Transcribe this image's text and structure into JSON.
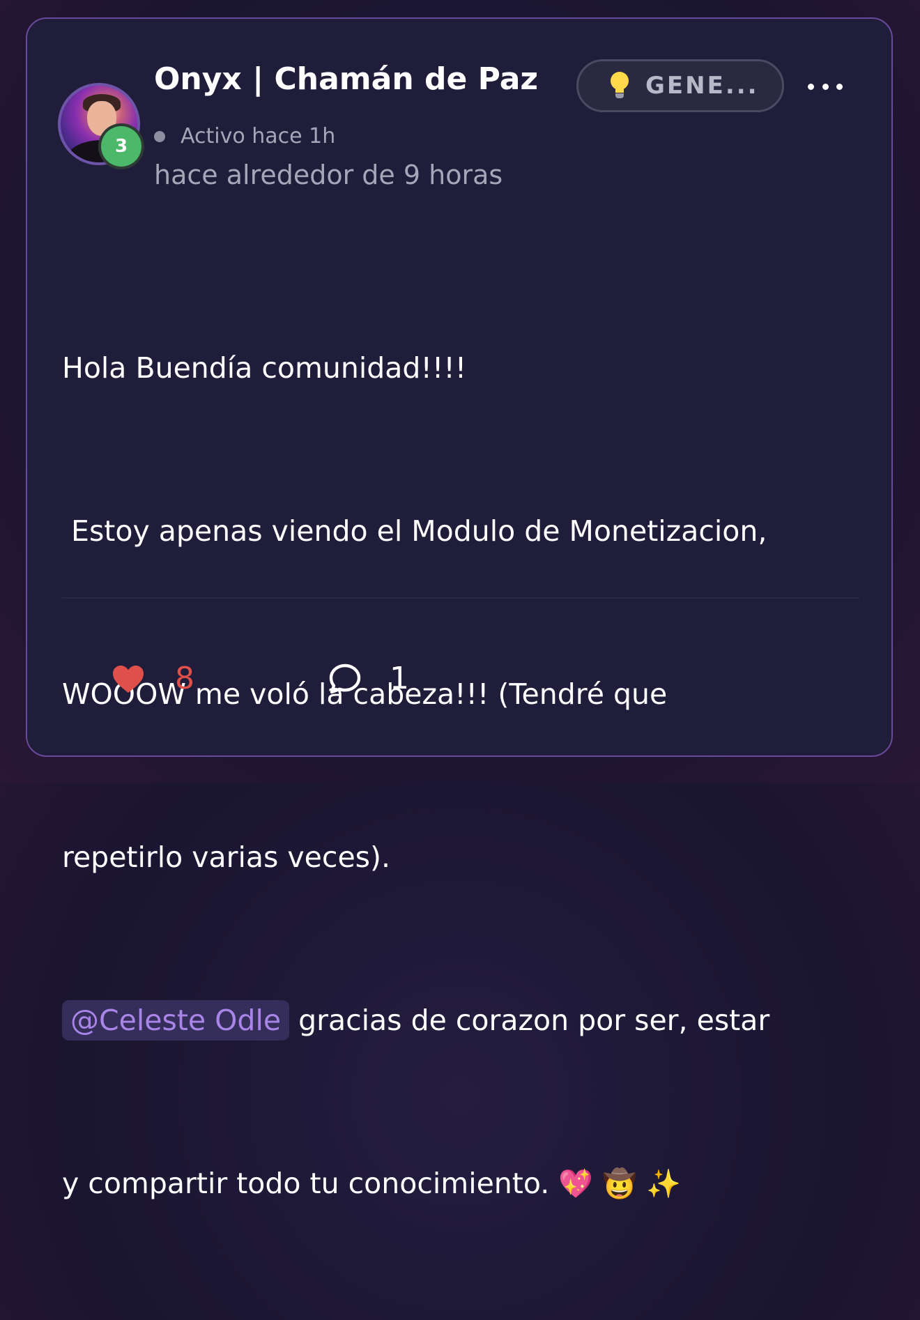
{
  "post": {
    "author_name": "Onyx | Chamán de Paz",
    "level": "3",
    "status_text": "Activo hace 1h",
    "timestamp": "hace alrededor de 9 horas",
    "category_label": "GENE...",
    "category_icon": "lightbulb-icon",
    "body": {
      "line1": "Hola Buendía comunidad!!!!",
      "line2": " Estoy apenas viendo el Modulo de Monetizacion,",
      "line3": "WOOOW me voló la cabeza!!! (Tendré que",
      "line4": "repetirlo varias veces).",
      "mention": "@Celeste Odle",
      "line5_rest": " gracias de corazon por ser, estar",
      "line6_text": "y compartir todo tu conocimiento. ",
      "emojis": [
        "💖",
        "🤠",
        "✨"
      ]
    },
    "likes_count": "8",
    "comments_count": "1"
  },
  "colors": {
    "card_background": "#1f1d3a",
    "card_border": "#6a4a9c",
    "level_badge": "#4cb86a",
    "mention_text": "#a985e8",
    "like_color": "#e0504a"
  }
}
